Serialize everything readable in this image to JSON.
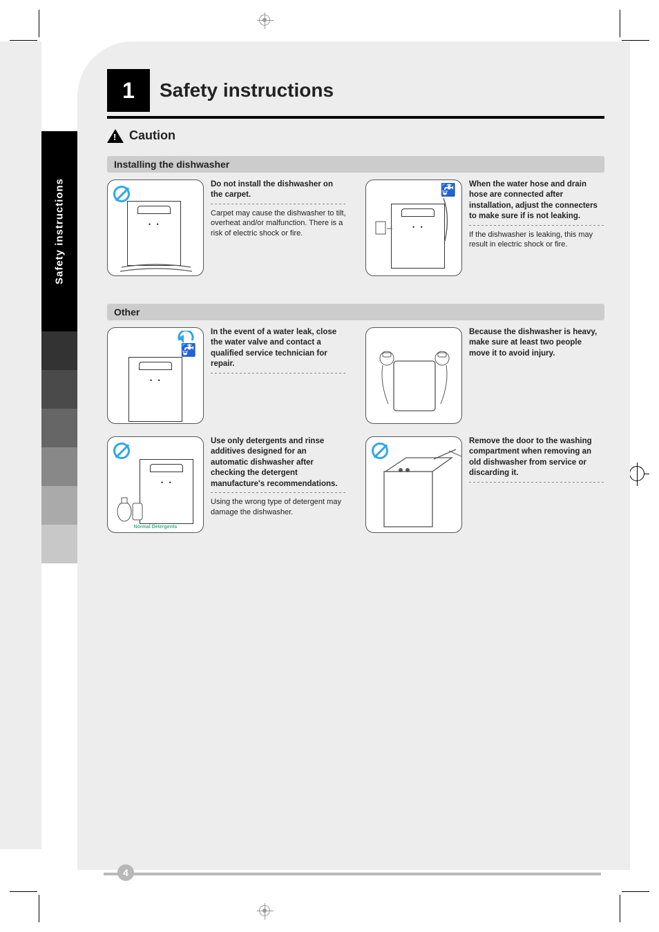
{
  "page": {
    "number_box": "1",
    "title": "Safety instructions",
    "caution": "Caution",
    "band_installing": "Installing the dishwasher",
    "band_other": "Other",
    "page_number": "4"
  },
  "tabs": {
    "safety": "Safety instructions"
  },
  "installing": {
    "fig1": {
      "head": "Do not install the dishwasher on the carpet.",
      "body": "Carpet may cause the dishwasher to tilt, overheat and/or malfunction. There is a risk of electric shock or fire."
    },
    "fig2": {
      "head": "When the water hose and drain hose are connected after installation, adjust the connecters to make sure if is not leaking.",
      "body": "If the dishwasher is leaking, this may result in electric shock or fire."
    }
  },
  "other": {
    "fig1": {
      "head": "In the event of a water leak, close the water valve and contact a qualified service technician for repair.",
      "body": ""
    },
    "fig2": {
      "head": "Because the dishwasher is heavy, make sure at least two people move it to avoid injury.",
      "body": ""
    },
    "fig3": {
      "head": "Use only detergents and rinse additives designed for an automatic dishwasher after checking the detergent manufacture's recommendations.",
      "body": "Using the wrong type of detergent may damage the dishwasher.",
      "label": "Normal Detergents"
    },
    "fig4": {
      "head": "Remove the door to the washing compartment when removing an old dishwasher from service or discarding it.",
      "body": ""
    }
  }
}
